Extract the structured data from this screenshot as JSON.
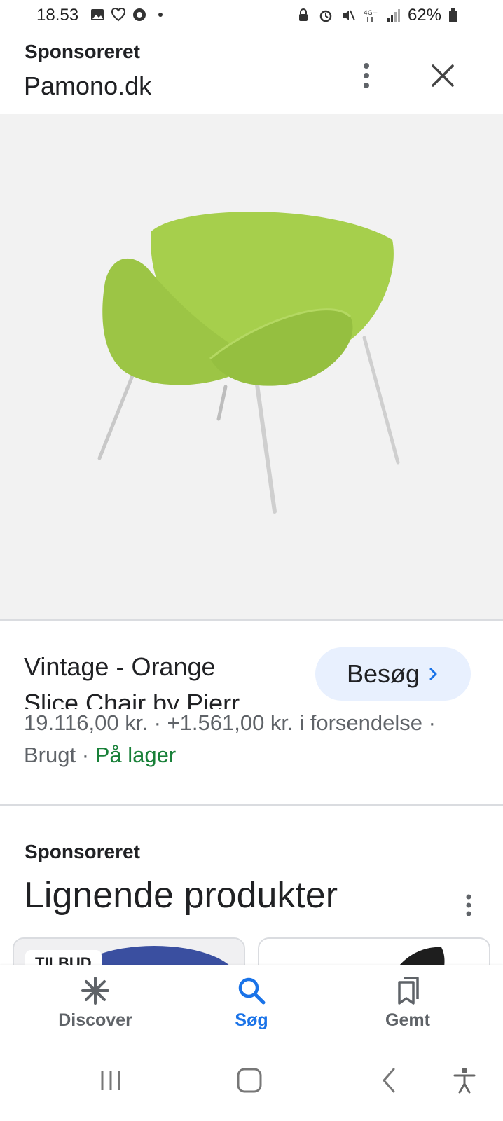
{
  "status_bar": {
    "time": "18.53",
    "battery": "62%",
    "network": "4G+"
  },
  "header": {
    "sponsored_label": "Sponsoreret",
    "site": "Pamono.dk"
  },
  "product": {
    "title_line1": "Vintage - Orange",
    "title_line2": "Slice Chair by Pierr…",
    "visit_label": "Besøg",
    "price": "19.116,00 kr.",
    "shipping": "+1.561,00 kr. i forsendelse",
    "condition": "Brugt",
    "stock": "På lager",
    "separator": "·"
  },
  "related": {
    "sponsored_label": "Sponsoreret",
    "title": "Lignende produkter",
    "card1_badge": "TILBUD"
  },
  "bottom_nav": {
    "items": [
      {
        "label": "Discover",
        "icon": "asterisk-icon"
      },
      {
        "label": "Søg",
        "icon": "search-icon",
        "active": true
      },
      {
        "label": "Gemt",
        "icon": "bookmarks-icon"
      }
    ]
  },
  "colors": {
    "accent": "#1a73e8",
    "visit_bg": "#e8f0fe",
    "in_stock": "#188038",
    "chair_green": "#a6cf4c"
  }
}
